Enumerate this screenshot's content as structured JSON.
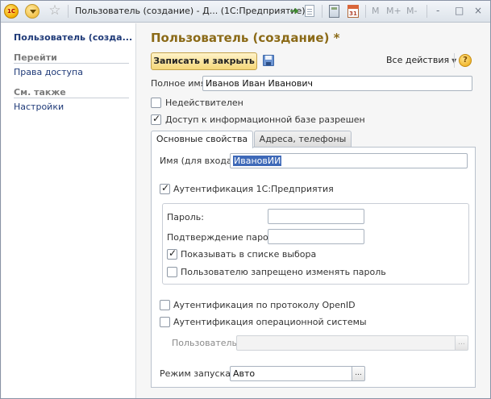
{
  "window": {
    "title": "Пользователь (создание) - Д...  (1С:Предприятие)",
    "logo_text": "1С",
    "mem_buttons": [
      "M",
      "M+",
      "M-"
    ],
    "controls": [
      "-",
      "□",
      "×"
    ]
  },
  "left_panel": {
    "title": "Пользователь (созда...",
    "sections": [
      {
        "label": "Перейти",
        "links": [
          "Права доступа"
        ]
      },
      {
        "label": "См. также",
        "links": [
          "Настройки"
        ]
      }
    ]
  },
  "form": {
    "title": "Пользователь (создание) *",
    "save_button": "Записать и закрыть",
    "all_actions": "Все действия",
    "help": "?",
    "full_name_label": "Полное имя:",
    "full_name_value": "Иванов Иван Иванович",
    "invalid_label": "Недействителен",
    "invalid_checked": false,
    "access_label": "Доступ к информационной базе разрешен",
    "access_checked": true
  },
  "tabs": [
    {
      "label": "Основные свойства",
      "active": true
    },
    {
      "label": "Адреса, телефоны",
      "active": false
    }
  ],
  "main_tab": {
    "login_label": "Имя (для входа):",
    "login_value": "ИвановИИ",
    "auth1c_label": "Аутентификация 1С:Предприятия",
    "auth1c_checked": true,
    "password_label": "Пароль:",
    "password_value": "",
    "confirm_label": "Подтверждение пароля:",
    "confirm_value": "",
    "show_in_list_label": "Показывать в списке выбора",
    "show_in_list_checked": true,
    "cannot_change_label": "Пользователю запрещено изменять пароль",
    "cannot_change_checked": false,
    "openid_label": "Аутентификация по протоколу OpenID",
    "openid_checked": false,
    "os_auth_label": "Аутентификация операционной системы",
    "os_auth_checked": false,
    "os_user_label": "Пользователь:",
    "os_user_value": "",
    "startup_label": "Режим запуска:",
    "startup_value": "Авто",
    "ellipsis": "..."
  }
}
